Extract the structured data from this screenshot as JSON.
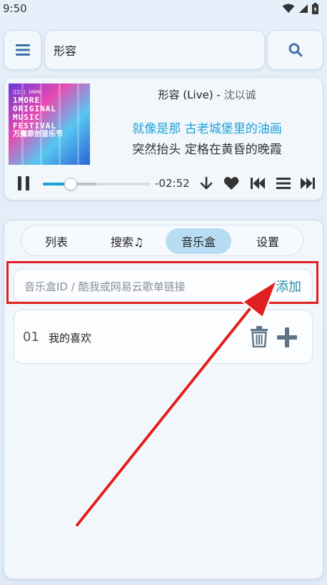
{
  "status_bar": {
    "time": "9:50"
  },
  "header": {
    "menu_icon": "hamburger-menu-icon",
    "search_value": "形容",
    "search_icon": "search-icon"
  },
  "player": {
    "album_art": {
      "lines": [
        "1MORE",
        "ORIGINAL",
        "MUSIC",
        "FESTIVAL",
        "万魔原创音乐节"
      ]
    },
    "title": "形容 (Live) - ",
    "artist": "沈以诚",
    "lyric_current": "就像是那 古老城堡里的油画",
    "lyric_next": "突然抬头 定格在黄昏的晚霞",
    "time_remaining": "-02:52",
    "progress_fraction": 0.26,
    "buffered_fraction": 0.5,
    "icons": [
      "pause-icon",
      "download-icon",
      "heart-icon",
      "previous-icon",
      "playlist-icon",
      "next-icon"
    ]
  },
  "tabs": [
    {
      "label": "列表",
      "active": false
    },
    {
      "label": "搜索♫",
      "active": false
    },
    {
      "label": "音乐盒",
      "active": true
    },
    {
      "label": "设置",
      "active": false
    }
  ],
  "music_box": {
    "input_placeholder": "音乐盒ID / 酷我或网易云歌单链接",
    "add_label": "添加",
    "items": [
      {
        "index": "01",
        "name": "我的喜欢"
      }
    ]
  },
  "colors": {
    "accent": "#1ea0d8",
    "active_tab": "#b9dcf5",
    "icon_blue": "#3b6fa8",
    "highlight": "#e02020"
  }
}
